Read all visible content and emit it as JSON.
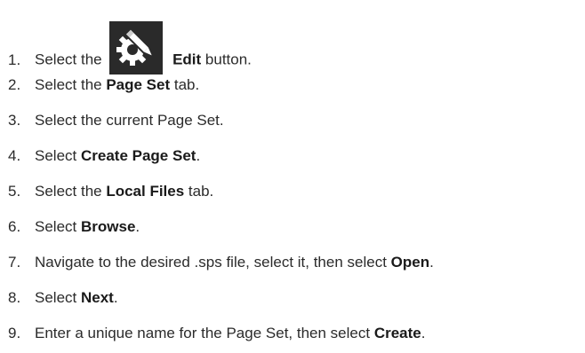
{
  "steps": [
    {
      "num": "1.",
      "pre": "Select the",
      "bold": "Edit",
      "post": " button.",
      "icon": "edit-gear-pencil-icon"
    },
    {
      "num": "2.",
      "pre": "Select the ",
      "bold": "Page Set",
      "post": " tab."
    },
    {
      "num": "3.",
      "pre": "Select the current Page Set.",
      "bold": "",
      "post": ""
    },
    {
      "num": "4.",
      "pre": "Select ",
      "bold": "Create Page Set",
      "post": "."
    },
    {
      "num": "5.",
      "pre": "Select the ",
      "bold": "Local Files",
      "post": " tab."
    },
    {
      "num": "6.",
      "pre": "Select ",
      "bold": "Browse",
      "post": "."
    },
    {
      "num": "7.",
      "pre": "Navigate to the desired .sps file, select it, then select ",
      "bold": "Open",
      "post": "."
    },
    {
      "num": "8.",
      "pre": "Select ",
      "bold": "Next",
      "post": "."
    },
    {
      "num": "9.",
      "pre": "Enter a unique name for the Page Set, then select ",
      "bold": "Create",
      "post": "."
    }
  ],
  "colors": {
    "text": "#2b2b2b",
    "icon_bg": "#2a2a2a",
    "icon_fg": "#ffffff"
  }
}
